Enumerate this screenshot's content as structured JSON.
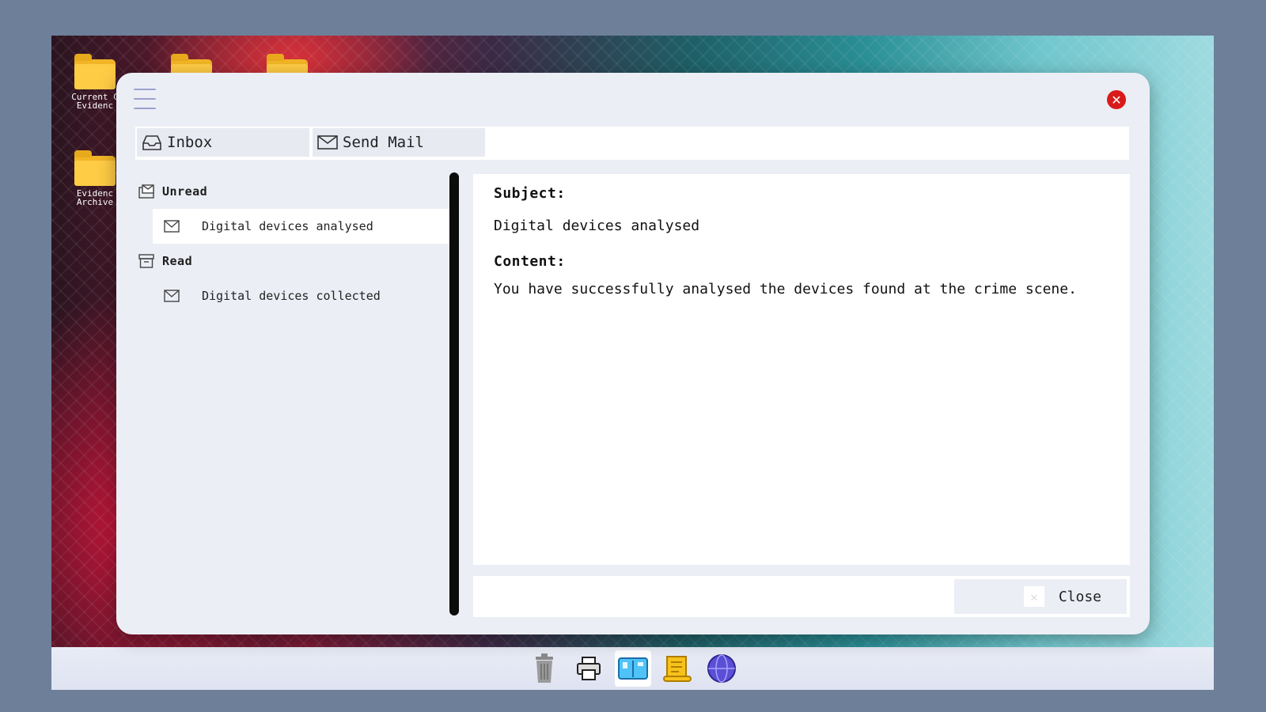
{
  "desktop": {
    "icons": [
      {
        "label": "Current C\nEvidenc",
        "icon": "folder-icon"
      },
      {
        "label": "",
        "icon": "folder-icon"
      },
      {
        "label": "",
        "icon": "folder-icon"
      },
      {
        "label": "Evidenc\nArchive",
        "icon": "folder-icon"
      }
    ]
  },
  "window": {
    "menu_icon": "hamburger-icon",
    "close_icon": "close-icon",
    "close_glyph": "✕",
    "tabs": [
      {
        "label": "Inbox",
        "icon": "inbox-icon"
      },
      {
        "label": "Send Mail",
        "icon": "envelope-icon"
      }
    ]
  },
  "mailbox": {
    "unread": {
      "title": "Unread",
      "items": [
        {
          "subject": "Digital devices analysed"
        }
      ]
    },
    "read": {
      "title": "Read",
      "items": [
        {
          "subject": "Digital devices collected"
        }
      ]
    }
  },
  "message": {
    "subject_label": "Subject:",
    "subject": "Digital devices analysed",
    "content_label": "Content:",
    "content": "You have successfully analysed the devices found at the crime scene."
  },
  "footer": {
    "close_label": "Close",
    "close_glyph": "✕"
  },
  "taskbar": {
    "items": [
      {
        "icon": "trash-icon"
      },
      {
        "icon": "printer-icon"
      },
      {
        "icon": "mail-app-icon",
        "active": true
      },
      {
        "icon": "scroll-icon"
      },
      {
        "icon": "globe-icon"
      }
    ]
  },
  "colors": {
    "accent_close": "#d91a1a",
    "window_bg": "#eceef5",
    "folder": "#ffcc45"
  }
}
